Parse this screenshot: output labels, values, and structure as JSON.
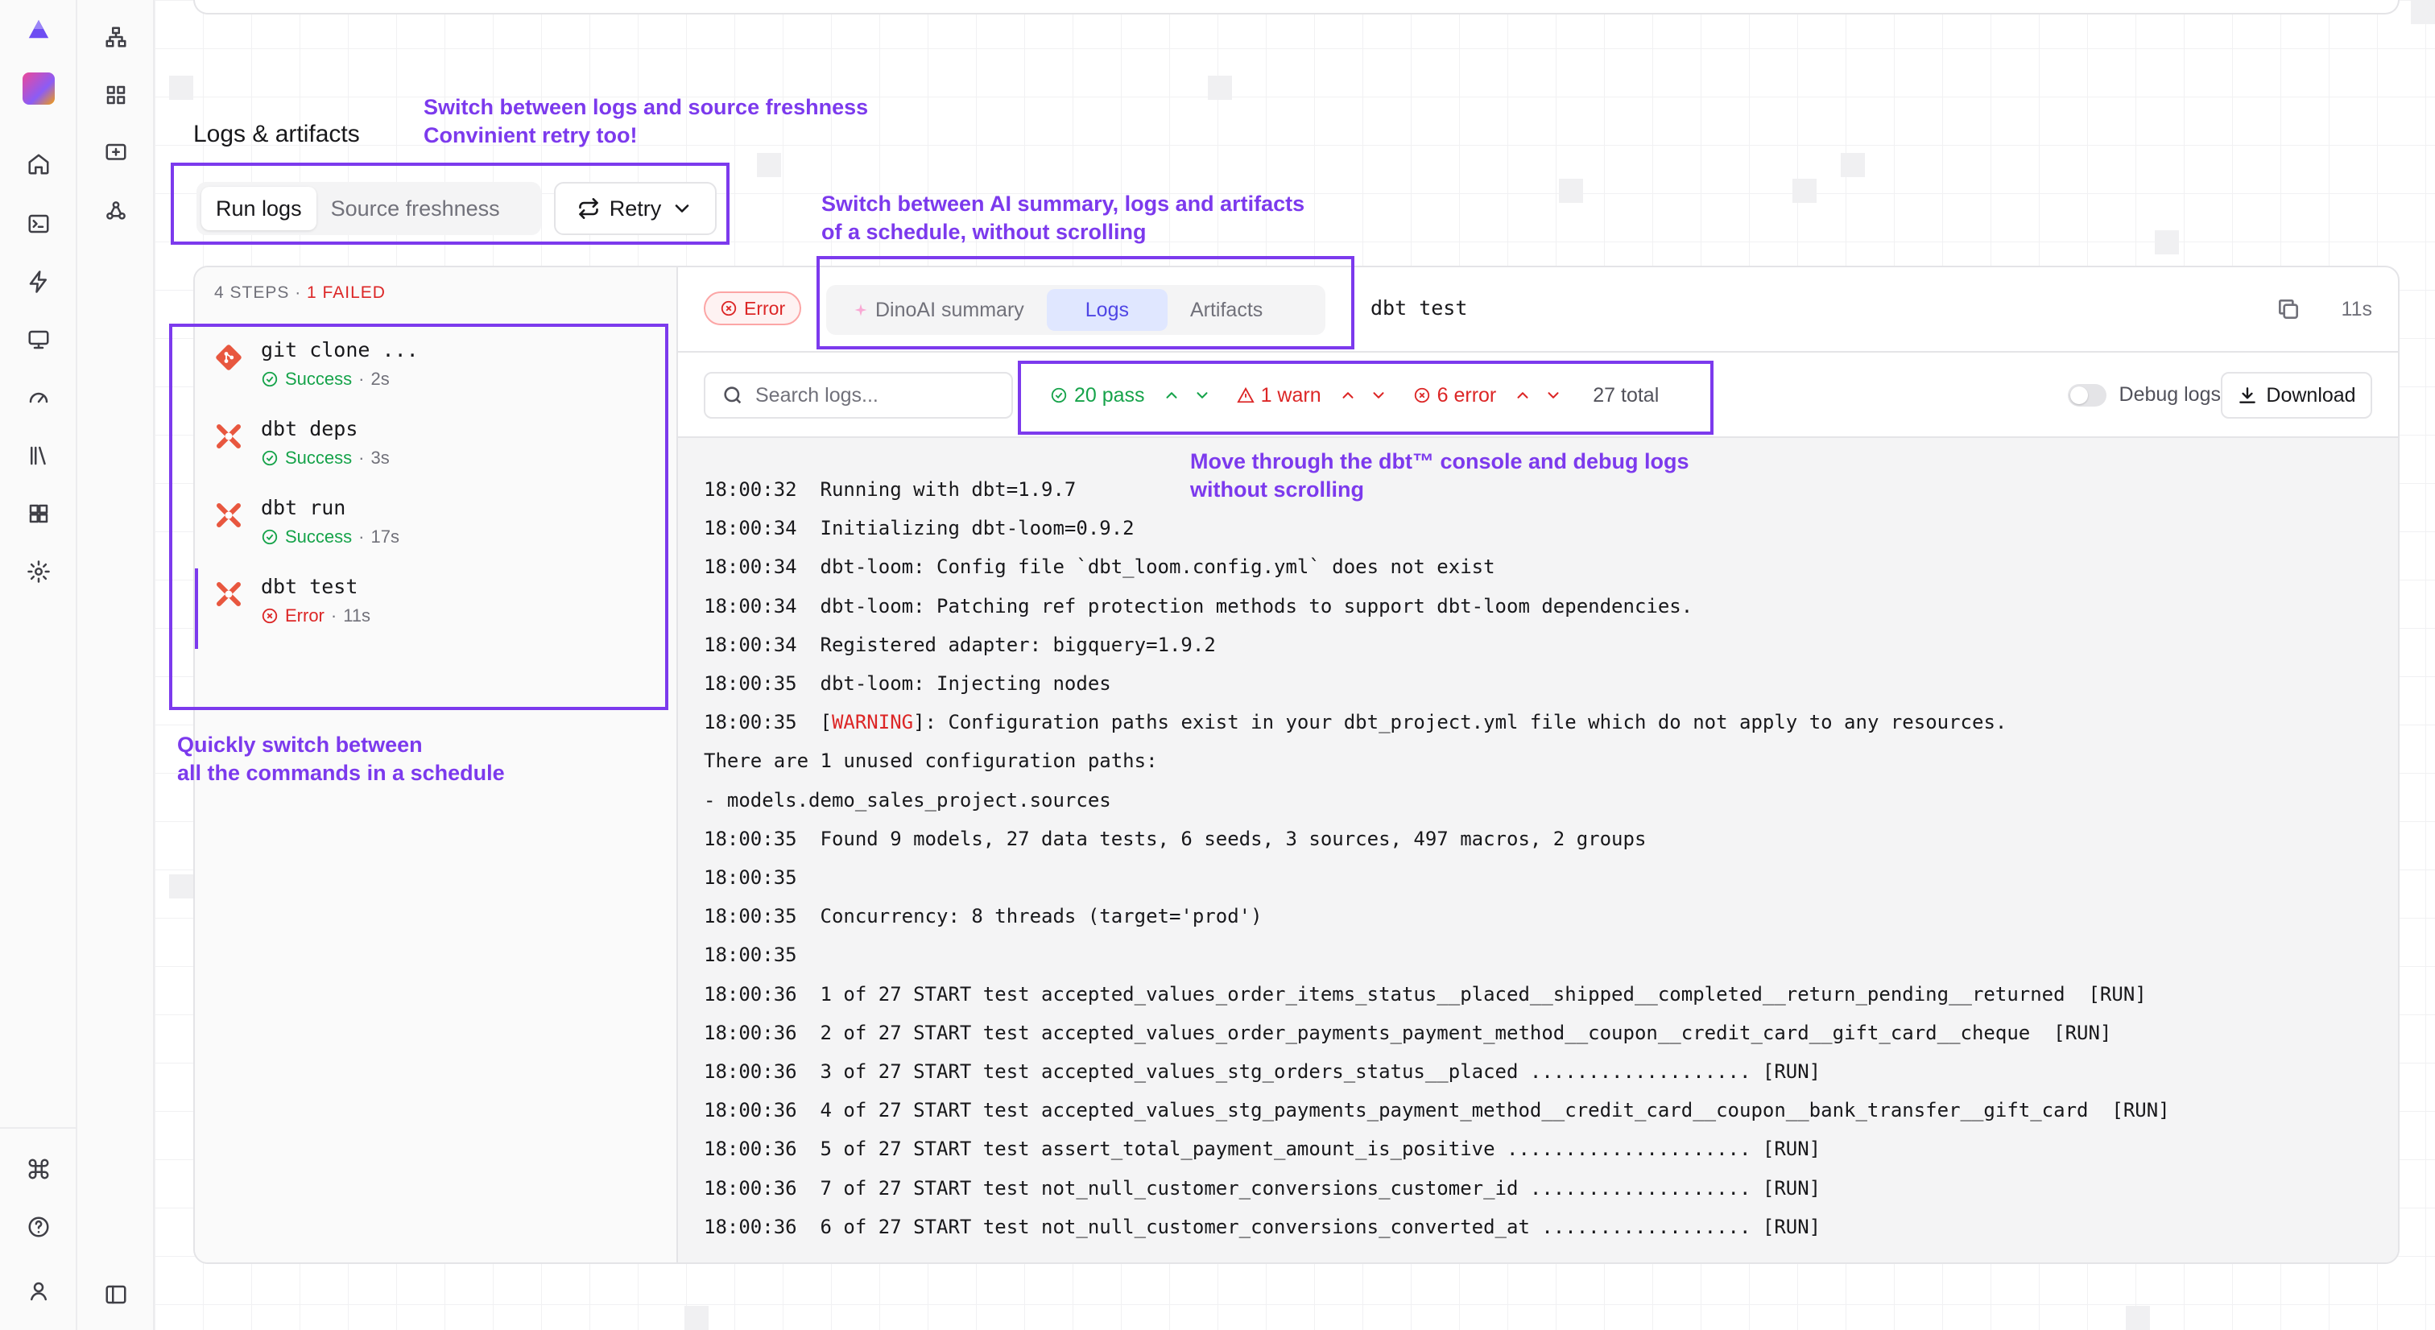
{
  "nav": {
    "primary_icons": [
      "logo-icon",
      "project-avatar",
      "home-icon",
      "terminal-icon",
      "lightning-icon",
      "monitor-icon",
      "gauge-icon",
      "library-icon",
      "layout-icon",
      "gear-icon",
      "command-icon",
      "help-icon",
      "user-icon"
    ],
    "secondary_icons": [
      "lineage-icon",
      "grid-icon",
      "add-comment-icon",
      "webhook-icon",
      "sidebar-toggle-icon"
    ]
  },
  "section": {
    "title": "Logs & artifacts"
  },
  "mode_tabs": [
    {
      "label": "Run logs",
      "active": true
    },
    {
      "label": "Source freshness",
      "active": false
    }
  ],
  "retry": {
    "label": "Retry"
  },
  "annotations": {
    "tabs": "Switch between logs and source freshness\nConvinient retry too!",
    "views": "Switch between AI summary, logs and artifacts\nof a schedule, without scrolling",
    "steps": "Quickly switch between\nall the commands in a schedule",
    "counts": "Move through the dbt™ console and debug logs\nwithout scrolling"
  },
  "steps": {
    "count_label": "4 STEPS",
    "separator": " · ",
    "failed_label": "1 FAILED",
    "items": [
      {
        "name": "git clone ...",
        "status": "Success",
        "duration": "2s",
        "type": "git"
      },
      {
        "name": "dbt deps",
        "status": "Success",
        "duration": "3s",
        "type": "dbt"
      },
      {
        "name": "dbt run",
        "status": "Success",
        "duration": "17s",
        "type": "dbt"
      },
      {
        "name": "dbt test",
        "status": "Error",
        "duration": "11s",
        "type": "dbt",
        "selected": true
      }
    ]
  },
  "detail": {
    "status_badge": "Error",
    "view_tabs": [
      {
        "label": "DinoAI summary",
        "active": false
      },
      {
        "label": "Logs",
        "active": true
      },
      {
        "label": "Artifacts",
        "active": false
      }
    ],
    "command": "dbt test",
    "duration": "11s"
  },
  "toolbar": {
    "search_placeholder": "Search logs...",
    "pass_label": "20 pass",
    "warn_label": "1 warn",
    "error_label": "6 error",
    "total_label": "27 total",
    "debug_label": "Debug logs",
    "debug_on": false,
    "download_label": "Download"
  },
  "logs": [
    {
      "t": "18:00:32",
      "msg": "Running with dbt=1.9.7"
    },
    {
      "t": "18:00:34",
      "msg": "Initializing dbt-loom=0.9.2"
    },
    {
      "t": "18:00:34",
      "msg": "dbt-loom: Config file `dbt_loom.config.yml` does not exist"
    },
    {
      "t": "18:00:34",
      "msg": "dbt-loom: Patching ref protection methods to support dbt-loom dependencies."
    },
    {
      "t": "18:00:34",
      "msg": "Registered adapter: bigquery=1.9.2"
    },
    {
      "t": "18:00:35",
      "msg": "dbt-loom: Injecting nodes"
    },
    {
      "t": "18:00:35",
      "pre": "[",
      "warn": "WARNING",
      "msg": "]: Configuration paths exist in your dbt_project.yml file which do not apply to any resources."
    },
    {
      "t": "",
      "msg": "There are 1 unused configuration paths:"
    },
    {
      "t": "",
      "msg": "- models.demo_sales_project.sources"
    },
    {
      "t": "18:00:35",
      "msg": "Found 9 models, 27 data tests, 6 seeds, 3 sources, 497 macros, 2 groups"
    },
    {
      "t": "18:00:35",
      "msg": ""
    },
    {
      "t": "18:00:35",
      "msg": "Concurrency: 8 threads (target='prod')"
    },
    {
      "t": "18:00:35",
      "msg": ""
    },
    {
      "t": "18:00:36",
      "msg": "1 of 27 START test accepted_values_order_items_status__placed__shipped__completed__return_pending__returned  [RUN]"
    },
    {
      "t": "18:00:36",
      "msg": "2 of 27 START test accepted_values_order_payments_payment_method__coupon__credit_card__gift_card__cheque  [RUN]"
    },
    {
      "t": "18:00:36",
      "msg": "3 of 27 START test accepted_values_stg_orders_status__placed ................... [RUN]"
    },
    {
      "t": "18:00:36",
      "msg": "4 of 27 START test accepted_values_stg_payments_payment_method__credit_card__coupon__bank_transfer__gift_card  [RUN]"
    },
    {
      "t": "18:00:36",
      "msg": "5 of 27 START test assert_total_payment_amount_is_positive ..................... [RUN]"
    },
    {
      "t": "18:00:36",
      "msg": "7 of 27 START test not_null_customer_conversions_customer_id ................... [RUN]"
    },
    {
      "t": "18:00:36",
      "msg": "6 of 27 START test not_null_customer_conversions_converted_at .................. [RUN]"
    }
  ],
  "colors": {
    "accent": "#7c3aed",
    "success": "#16a34a",
    "error": "#dc2626",
    "dbt_orange": "#e8573f"
  }
}
